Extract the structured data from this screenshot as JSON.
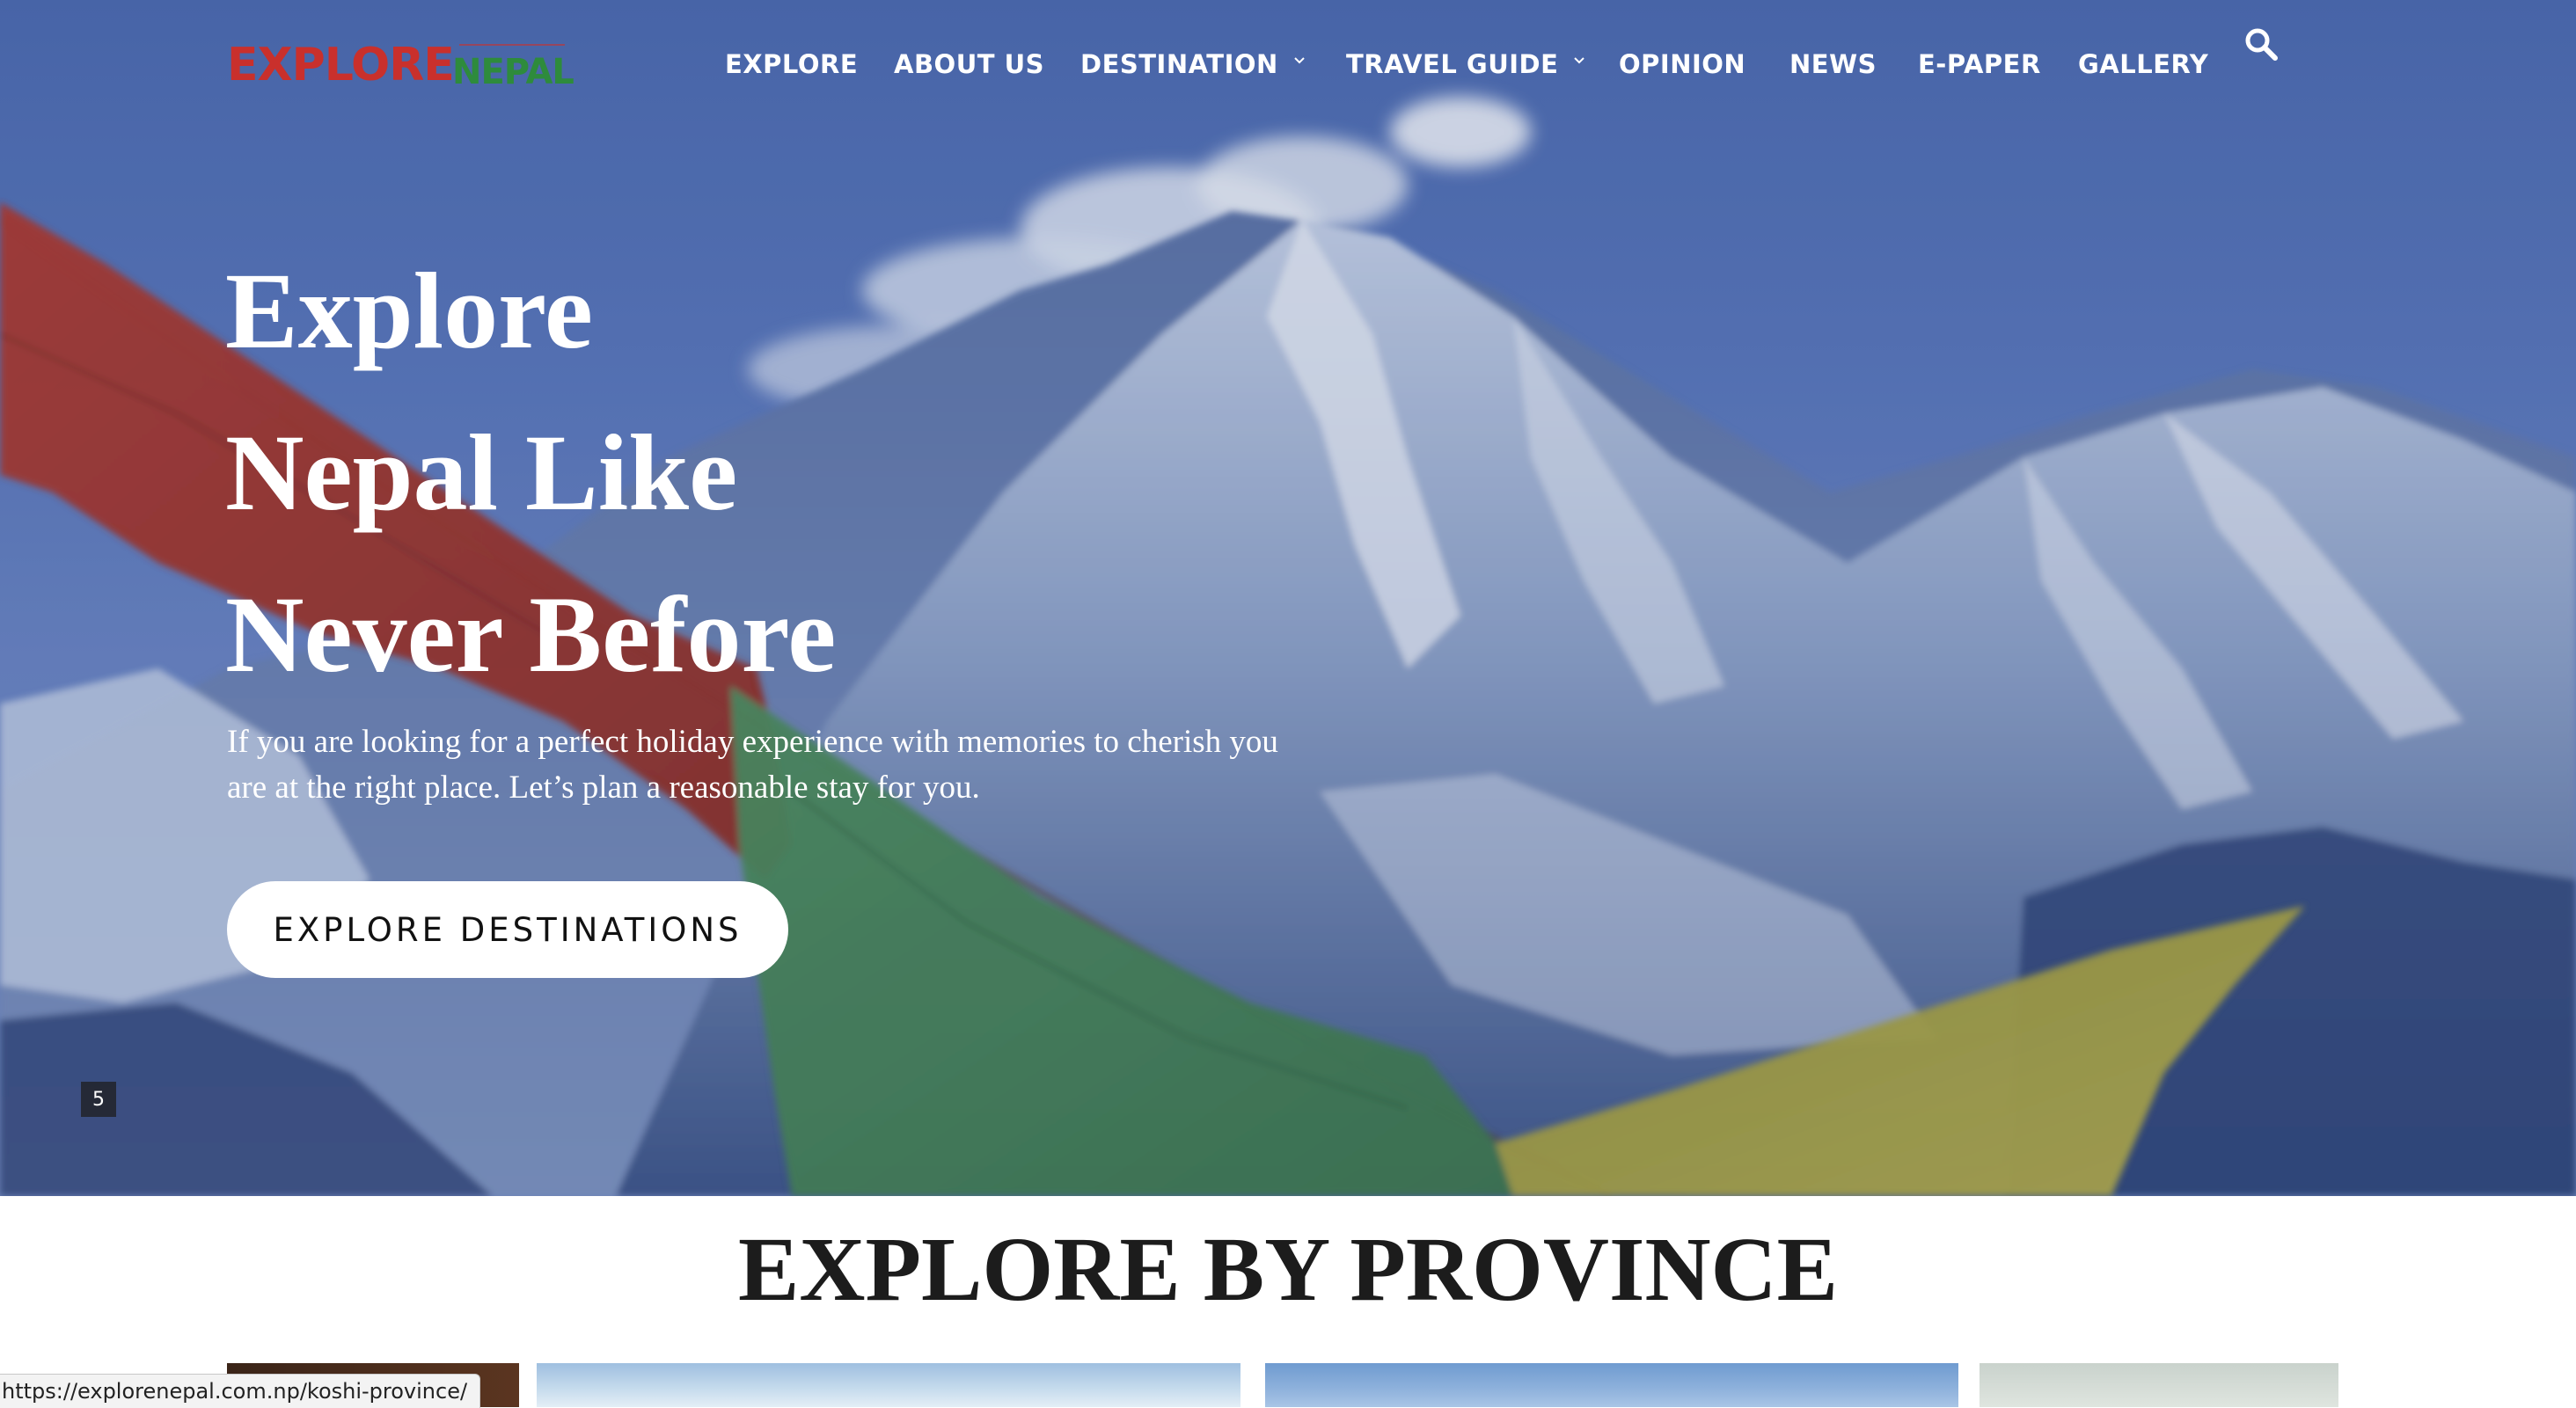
{
  "site": {
    "logo_word1": "EXPLORE",
    "logo_word2": "NEPAL"
  },
  "nav": {
    "items": [
      {
        "label": "EXPLORE",
        "has_dropdown": false
      },
      {
        "label": "ABOUT US",
        "has_dropdown": false
      },
      {
        "label": "DESTINATION",
        "has_dropdown": true
      },
      {
        "label": "TRAVEL GUIDE",
        "has_dropdown": true
      },
      {
        "label": "OPINION",
        "has_dropdown": false
      },
      {
        "label": "NEWS",
        "has_dropdown": false
      },
      {
        "label": "E-PAPER",
        "has_dropdown": false
      },
      {
        "label": "GALLERY",
        "has_dropdown": false
      }
    ],
    "search_icon": "search-icon"
  },
  "hero": {
    "headline_lines": [
      "Explore",
      "Nepal Like",
      "Never Before"
    ],
    "subtext": "If you are looking for a perfect holiday experience with memories to cherish you are at the right place. Let’s plan a reasonable stay for you.",
    "cta_label": "EXPLORE DESTINATIONS",
    "slide_number": "5"
  },
  "provinces": {
    "title": "EXPLORE BY PROVINCE"
  },
  "status_bar": {
    "url": "https://explorenepal.com.np/koshi-province/"
  },
  "colors": {
    "logo_red": "#c9302c",
    "logo_green": "#2e8b3c",
    "nav_text": "#ffffff",
    "cta_bg": "#ffffff"
  }
}
